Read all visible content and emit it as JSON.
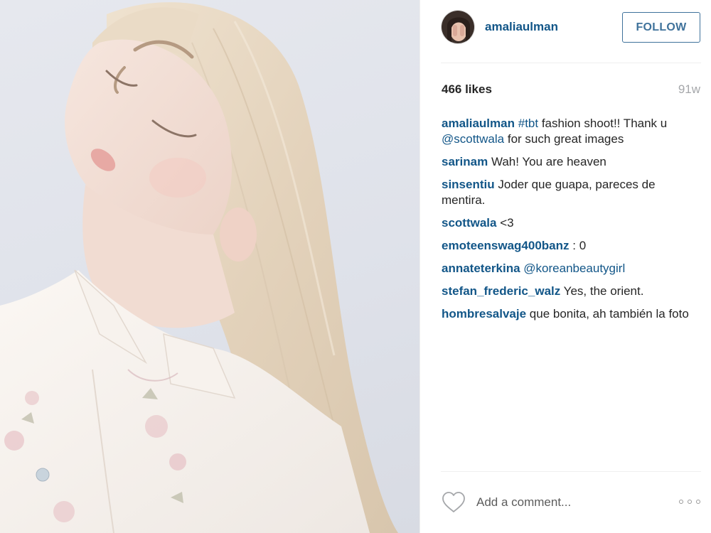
{
  "post": {
    "username": "amaliaulman",
    "follow_label": "FOLLOW",
    "likes": "466 likes",
    "age": "91w",
    "comments": [
      {
        "author": "amaliaulman",
        "parts": [
          {
            "text": "#tbt",
            "link": true
          },
          {
            "text": " fashion shoot!! Thank u ",
            "link": false
          },
          {
            "text": "@scottwala",
            "link": true
          },
          {
            "text": " for such great images",
            "link": false
          }
        ]
      },
      {
        "author": "sarinam",
        "parts": [
          {
            "text": "Wah! You are heaven",
            "link": false
          }
        ]
      },
      {
        "author": "sinsentiu",
        "parts": [
          {
            "text": "Joder que guapa, pareces de mentira.",
            "link": false
          }
        ]
      },
      {
        "author": "scottwala",
        "parts": [
          {
            "text": "<3",
            "link": false
          }
        ]
      },
      {
        "author": "emoteenswag400banz",
        "parts": [
          {
            "text": ": 0",
            "link": false
          }
        ]
      },
      {
        "author": "annateterkina",
        "parts": [
          {
            "text": "@koreanbeautygirl",
            "link": true
          }
        ]
      },
      {
        "author": "stefan_frederic_walz",
        "parts": [
          {
            "text": "Yes, the orient.",
            "link": false
          }
        ]
      },
      {
        "author": "hombresalvaje",
        "parts": [
          {
            "text": "que bonita, ah también la foto",
            "link": false
          }
        ]
      }
    ]
  },
  "footer": {
    "comment_placeholder": "Add a comment...",
    "like_icon": "heart-outline-icon",
    "more_icon": "more-options-icon"
  },
  "colors": {
    "link": "#125688",
    "text": "#262626",
    "muted": "#a5a7aa",
    "follow": "#3f729b",
    "divider": "#efefef"
  }
}
